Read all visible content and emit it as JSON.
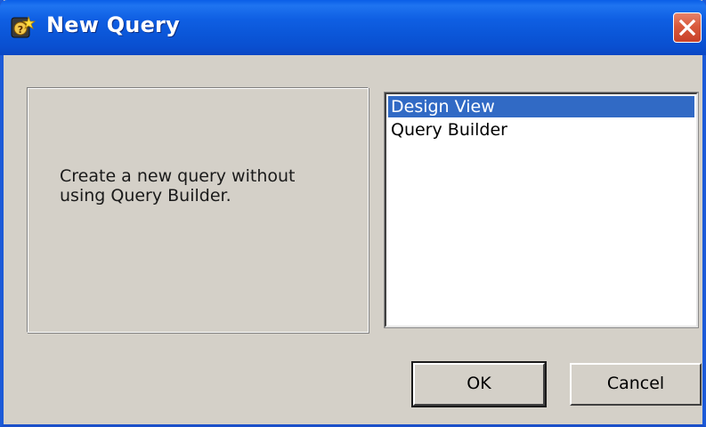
{
  "window": {
    "title": "New Query",
    "icon": "query-app-icon",
    "close_icon": "close-icon"
  },
  "description": {
    "text": "Create a new query without using Query Builder."
  },
  "query_type_list": {
    "items": [
      {
        "label": "Design View",
        "selected": true
      },
      {
        "label": "Query Builder",
        "selected": false
      }
    ]
  },
  "buttons": {
    "ok_label": "OK",
    "cancel_label": "Cancel"
  },
  "colors": {
    "title_bar": "#0a5ee7",
    "dialog_face": "#d4d0c8",
    "selection": "#316ac5",
    "close_button": "#d95a3c"
  }
}
